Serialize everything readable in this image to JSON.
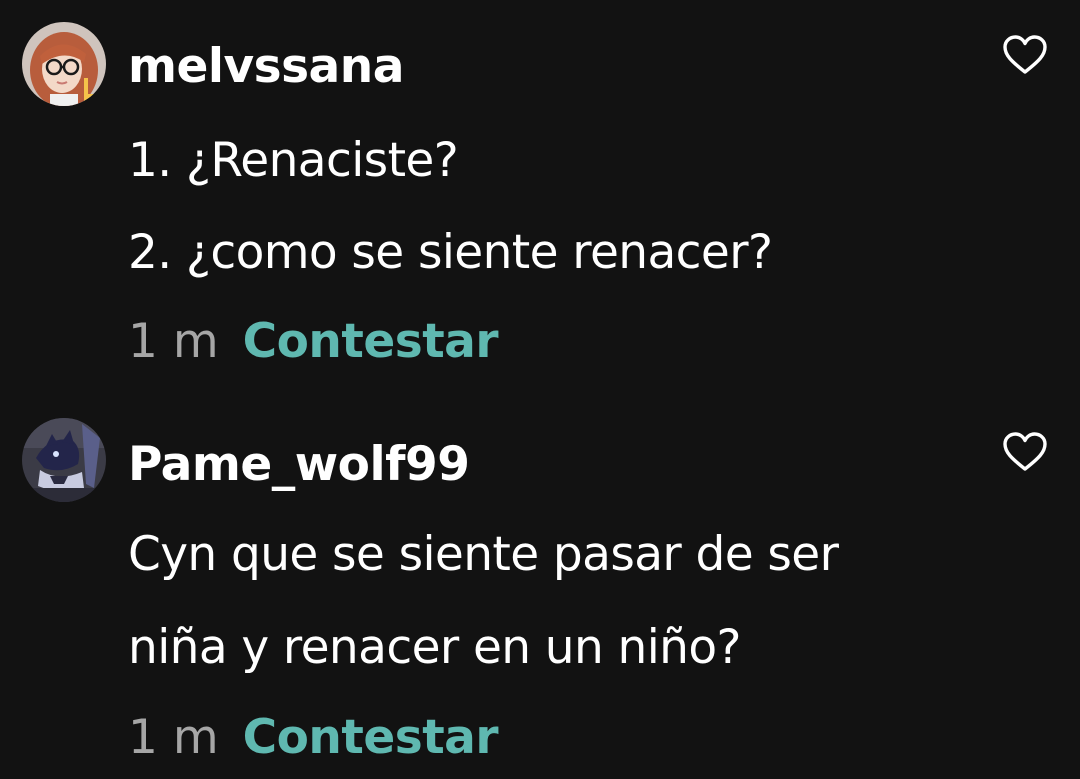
{
  "comments": [
    {
      "username": "melvssana",
      "avatar_icon": "avatar-girl-with-glasses-icon",
      "lines": [
        "1. ¿Renaciste?",
        "2. ¿como se siente renacer?"
      ],
      "time": "1 m",
      "reply_label": "Contestar",
      "like_icon": "heart-outline-icon"
    },
    {
      "username": "Pame_wolf99",
      "avatar_icon": "avatar-wolf-character-icon",
      "lines": [
        "Cyn que se siente pasar de ser",
        "niña y renacer en un niño?"
      ],
      "time": "1 m",
      "reply_label": "Contestar",
      "like_icon": "heart-outline-icon"
    }
  ],
  "colors": {
    "background": "#121212",
    "text": "#ffffff",
    "timestamp": "#a6a6a6",
    "reply_accent": "#5fb8b0"
  }
}
